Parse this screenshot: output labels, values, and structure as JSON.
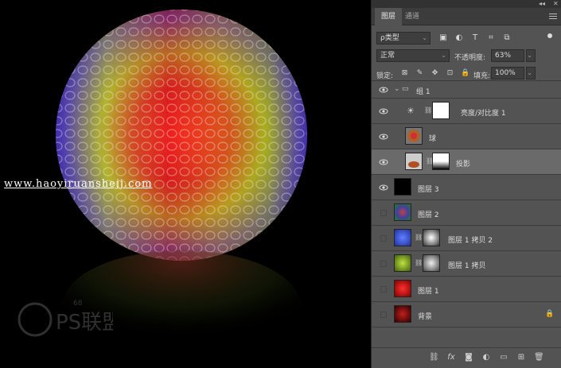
{
  "canvas": {
    "watermark_text": "www.haoyiruanshejj.com",
    "logo_text": "PS联盟",
    "logo_small": "68"
  },
  "panel": {
    "top_collapse": "◂◂",
    "top_close": "✕",
    "tabs": [
      {
        "label": "图层",
        "active": true
      },
      {
        "label": "通道",
        "active": false
      }
    ],
    "filter": {
      "kind_label": "ρ类型",
      "icons": [
        "image-filter-icon",
        "adjustment-filter-icon",
        "type-filter-icon",
        "shape-filter-icon",
        "smart-object-filter-icon"
      ]
    },
    "blend": {
      "mode": "正常",
      "opacity_label": "不透明度:",
      "opacity_value": "63%"
    },
    "lock": {
      "label": "锁定:",
      "fill_label": "填充:",
      "fill_value": "100%"
    },
    "layers": [
      {
        "name": "组 1",
        "type": "group",
        "visible": true
      },
      {
        "name": "亮度/对比度 1",
        "type": "adjustment",
        "visible": true
      },
      {
        "name": "球",
        "type": "smart",
        "visible": true
      },
      {
        "name": "投影",
        "type": "masked",
        "visible": true,
        "selected": true
      },
      {
        "name": "图层 3",
        "type": "black",
        "visible": true
      },
      {
        "name": "图层 2",
        "type": "pattern",
        "visible": false
      },
      {
        "name": "图层 1 拷贝 2",
        "type": "masked-blue",
        "visible": false
      },
      {
        "name": "图层 1 拷贝",
        "type": "masked-green",
        "visible": false
      },
      {
        "name": "图层 1",
        "type": "red",
        "visible": false
      },
      {
        "name": "背景",
        "type": "background",
        "visible": false,
        "locked": true
      }
    ],
    "bottom_icons": [
      "link-layers-icon",
      "fx-icon",
      "add-mask-icon",
      "adjustment-layer-icon",
      "new-group-icon",
      "new-layer-icon",
      "delete-layer-icon"
    ]
  }
}
